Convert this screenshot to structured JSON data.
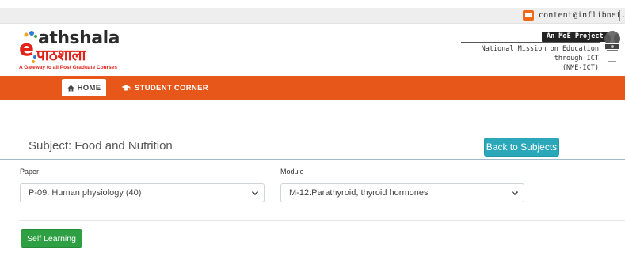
{
  "topbar": {
    "email": "content@inflibnet.ac.in",
    "mail_icon": "mail-icon"
  },
  "header": {
    "logo_en": "athshala",
    "logo_hi": "पाठशाला",
    "tagline": "A Gateway to all Post Graduate Courses",
    "badge": "An MoE Project",
    "mission_line1": "National Mission on Education through ICT",
    "mission_line2": "(NME-ICT)"
  },
  "nav": {
    "home": {
      "label": "HOME",
      "icon": "home-icon"
    },
    "student": {
      "label": "STUDENT CORNER",
      "icon": "graduation-cap-icon"
    }
  },
  "subject": {
    "title": "Subject: Food and Nutrition",
    "back_button": "Back to Subjects"
  },
  "paper": {
    "label": "Paper",
    "selected": "P-09. Human physiology (40)"
  },
  "module": {
    "label": "Module",
    "selected": "M-12.Parathyroid, thyroid hormones"
  },
  "actions": {
    "self_learning": "Self Learning"
  },
  "colors": {
    "nav_bg": "#e8571a",
    "back_button": "#2aa7b9",
    "self_learning": "#2ea043",
    "brand_red": "#e2231a"
  }
}
